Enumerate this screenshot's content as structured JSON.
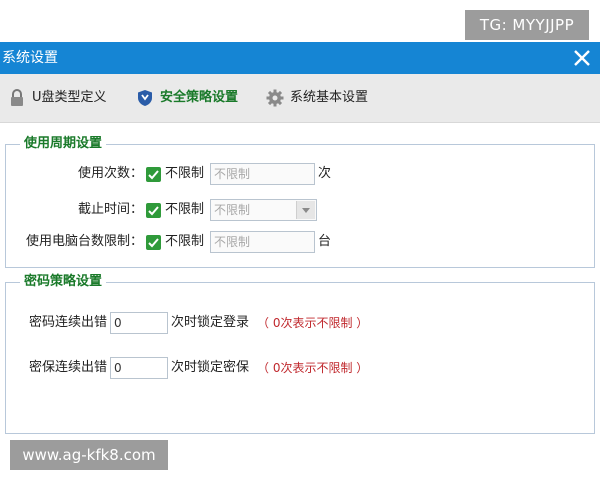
{
  "watermark_top": "TG: MYYJJPP",
  "watermark_bottom": "www.ag-kfk8.com",
  "window": {
    "title": "系统设置",
    "close_label": "×"
  },
  "tabs": [
    {
      "label": "U盘类型定义",
      "icon": "lock-icon"
    },
    {
      "label": "安全策略设置",
      "icon": "shield-icon",
      "active": true
    },
    {
      "label": "系统基本设置",
      "icon": "gear-icon"
    }
  ],
  "usage_section": {
    "title": "使用周期设置",
    "rows": [
      {
        "label": "使用次数：",
        "checkbox_label": "不限制",
        "checked": true,
        "input_placeholder": "不限制",
        "unit": "次"
      },
      {
        "label": "截止时间：",
        "checkbox_label": "不限制",
        "checked": true,
        "select_value": "不限制"
      },
      {
        "label": "使用电脑台数限制：",
        "checkbox_label": "不限制",
        "checked": true,
        "input_placeholder": "不限制",
        "unit": "台"
      }
    ]
  },
  "password_section": {
    "title": "密码策略设置",
    "rows": [
      {
        "label": "密码连续出错",
        "value": "0",
        "suffix": "次时锁定登录",
        "note": "（ 0次表示不限制 ）"
      },
      {
        "label": "密保连续出错",
        "value": "0",
        "suffix": "次时锁定密保",
        "note": "（ 0次表示不限制 ）"
      }
    ]
  },
  "colors": {
    "titlebar": "#1585d4",
    "accent_green": "#1a7a2a",
    "note_red": "#c0282d",
    "checkbox": "#2f9a3a"
  }
}
